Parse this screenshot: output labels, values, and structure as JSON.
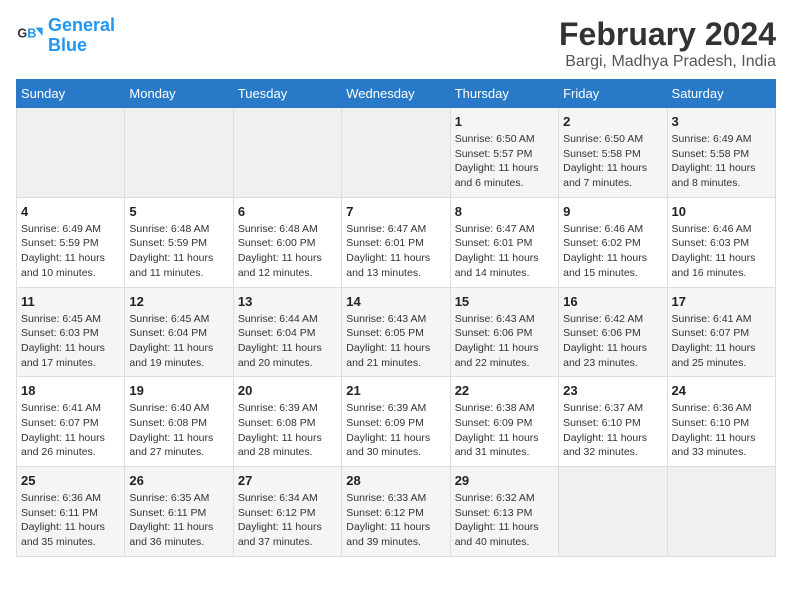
{
  "header": {
    "logo_line1": "General",
    "logo_line2": "Blue",
    "month_year": "February 2024",
    "location": "Bargi, Madhya Pradesh, India"
  },
  "weekdays": [
    "Sunday",
    "Monday",
    "Tuesday",
    "Wednesday",
    "Thursday",
    "Friday",
    "Saturday"
  ],
  "weeks": [
    [
      {
        "day": "",
        "empty": true
      },
      {
        "day": "",
        "empty": true
      },
      {
        "day": "",
        "empty": true
      },
      {
        "day": "",
        "empty": true
      },
      {
        "day": "1",
        "sunrise": "6:50 AM",
        "sunset": "5:57 PM",
        "daylight": "11 hours and 6 minutes."
      },
      {
        "day": "2",
        "sunrise": "6:50 AM",
        "sunset": "5:58 PM",
        "daylight": "11 hours and 7 minutes."
      },
      {
        "day": "3",
        "sunrise": "6:49 AM",
        "sunset": "5:58 PM",
        "daylight": "11 hours and 8 minutes."
      }
    ],
    [
      {
        "day": "4",
        "sunrise": "6:49 AM",
        "sunset": "5:59 PM",
        "daylight": "11 hours and 10 minutes."
      },
      {
        "day": "5",
        "sunrise": "6:48 AM",
        "sunset": "5:59 PM",
        "daylight": "11 hours and 11 minutes."
      },
      {
        "day": "6",
        "sunrise": "6:48 AM",
        "sunset": "6:00 PM",
        "daylight": "11 hours and 12 minutes."
      },
      {
        "day": "7",
        "sunrise": "6:47 AM",
        "sunset": "6:01 PM",
        "daylight": "11 hours and 13 minutes."
      },
      {
        "day": "8",
        "sunrise": "6:47 AM",
        "sunset": "6:01 PM",
        "daylight": "11 hours and 14 minutes."
      },
      {
        "day": "9",
        "sunrise": "6:46 AM",
        "sunset": "6:02 PM",
        "daylight": "11 hours and 15 minutes."
      },
      {
        "day": "10",
        "sunrise": "6:46 AM",
        "sunset": "6:03 PM",
        "daylight": "11 hours and 16 minutes."
      }
    ],
    [
      {
        "day": "11",
        "sunrise": "6:45 AM",
        "sunset": "6:03 PM",
        "daylight": "11 hours and 17 minutes."
      },
      {
        "day": "12",
        "sunrise": "6:45 AM",
        "sunset": "6:04 PM",
        "daylight": "11 hours and 19 minutes."
      },
      {
        "day": "13",
        "sunrise": "6:44 AM",
        "sunset": "6:04 PM",
        "daylight": "11 hours and 20 minutes."
      },
      {
        "day": "14",
        "sunrise": "6:43 AM",
        "sunset": "6:05 PM",
        "daylight": "11 hours and 21 minutes."
      },
      {
        "day": "15",
        "sunrise": "6:43 AM",
        "sunset": "6:06 PM",
        "daylight": "11 hours and 22 minutes."
      },
      {
        "day": "16",
        "sunrise": "6:42 AM",
        "sunset": "6:06 PM",
        "daylight": "11 hours and 23 minutes."
      },
      {
        "day": "17",
        "sunrise": "6:41 AM",
        "sunset": "6:07 PM",
        "daylight": "11 hours and 25 minutes."
      }
    ],
    [
      {
        "day": "18",
        "sunrise": "6:41 AM",
        "sunset": "6:07 PM",
        "daylight": "11 hours and 26 minutes."
      },
      {
        "day": "19",
        "sunrise": "6:40 AM",
        "sunset": "6:08 PM",
        "daylight": "11 hours and 27 minutes."
      },
      {
        "day": "20",
        "sunrise": "6:39 AM",
        "sunset": "6:08 PM",
        "daylight": "11 hours and 28 minutes."
      },
      {
        "day": "21",
        "sunrise": "6:39 AM",
        "sunset": "6:09 PM",
        "daylight": "11 hours and 30 minutes."
      },
      {
        "day": "22",
        "sunrise": "6:38 AM",
        "sunset": "6:09 PM",
        "daylight": "11 hours and 31 minutes."
      },
      {
        "day": "23",
        "sunrise": "6:37 AM",
        "sunset": "6:10 PM",
        "daylight": "11 hours and 32 minutes."
      },
      {
        "day": "24",
        "sunrise": "6:36 AM",
        "sunset": "6:10 PM",
        "daylight": "11 hours and 33 minutes."
      }
    ],
    [
      {
        "day": "25",
        "sunrise": "6:36 AM",
        "sunset": "6:11 PM",
        "daylight": "11 hours and 35 minutes."
      },
      {
        "day": "26",
        "sunrise": "6:35 AM",
        "sunset": "6:11 PM",
        "daylight": "11 hours and 36 minutes."
      },
      {
        "day": "27",
        "sunrise": "6:34 AM",
        "sunset": "6:12 PM",
        "daylight": "11 hours and 37 minutes."
      },
      {
        "day": "28",
        "sunrise": "6:33 AM",
        "sunset": "6:12 PM",
        "daylight": "11 hours and 39 minutes."
      },
      {
        "day": "29",
        "sunrise": "6:32 AM",
        "sunset": "6:13 PM",
        "daylight": "11 hours and 40 minutes."
      },
      {
        "day": "",
        "empty": true
      },
      {
        "day": "",
        "empty": true
      }
    ]
  ]
}
